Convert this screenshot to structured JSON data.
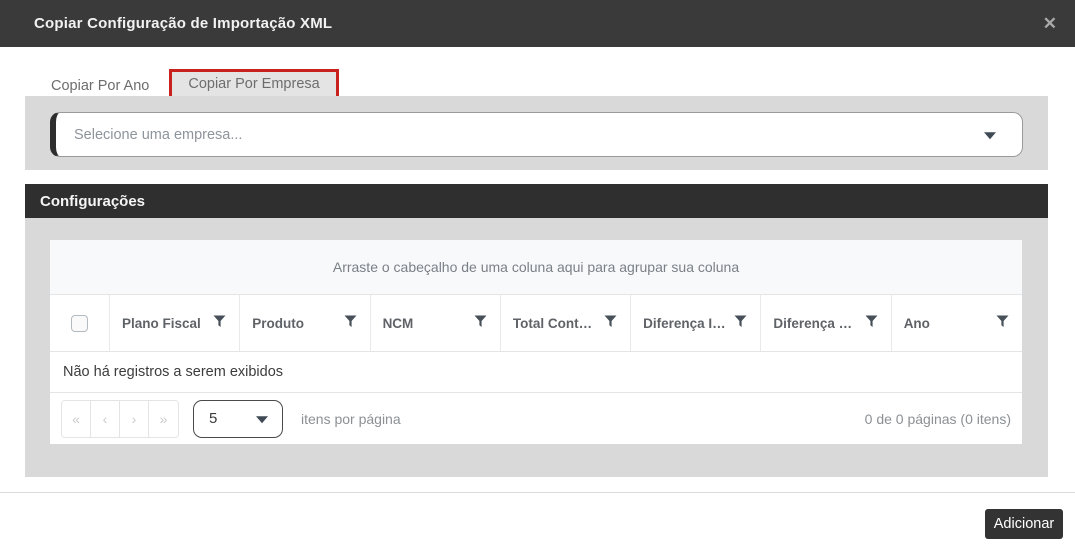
{
  "modal": {
    "title": "Copiar Configuração de Importação XML",
    "close_glyph": "✕"
  },
  "tabs": [
    {
      "label": "Copiar Por Ano",
      "active": false
    },
    {
      "label": "Copiar Por Empresa",
      "active": true
    }
  ],
  "company_select": {
    "placeholder": "Selecione uma empresa..."
  },
  "config_section": {
    "title": "Configurações"
  },
  "table": {
    "group_hint": "Arraste o cabeçalho de uma coluna aqui para agrupar sua coluna",
    "columns": [
      "Plano Fiscal",
      "Produto",
      "NCM",
      "Total Cont…",
      "Diferença I…",
      "Diferença …",
      "Ano"
    ],
    "empty_message": "Não há registros a serem exibidos"
  },
  "pagination": {
    "buttons": [
      {
        "name": "first-page-button",
        "glyph": "«"
      },
      {
        "name": "prev-page-button",
        "glyph": "‹"
      },
      {
        "name": "next-page-button",
        "glyph": "›"
      },
      {
        "name": "last-page-button",
        "glyph": "»"
      }
    ],
    "page_size": "5",
    "page_size_suffix": "itens por página",
    "summary": "0 de 0 páginas (0 itens)"
  },
  "footer": {
    "add_label": "Adicionar"
  },
  "colors": {
    "titlebar": "#3a3a3a",
    "section_bar": "#2f2f2f",
    "panel_gray": "#d9d9d9",
    "annotation_red": "#c9211e",
    "button_dark": "#333333"
  }
}
